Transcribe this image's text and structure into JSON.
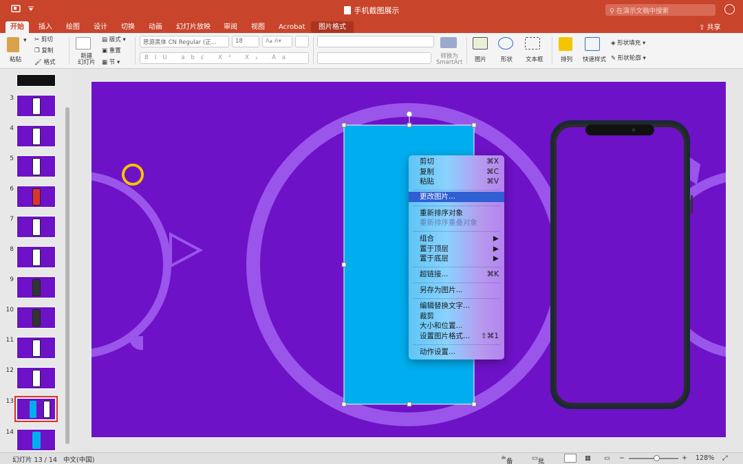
{
  "window": {
    "title": "手机截图展示",
    "search_placeholder": "在演示文稿中搜索"
  },
  "tabs": [
    {
      "label": "开始"
    },
    {
      "label": "插入"
    },
    {
      "label": "绘图"
    },
    {
      "label": "设计"
    },
    {
      "label": "切换"
    },
    {
      "label": "动画"
    },
    {
      "label": "幻灯片放映"
    },
    {
      "label": "审阅"
    },
    {
      "label": "视图"
    },
    {
      "label": "Acrobat"
    },
    {
      "label": "图片格式"
    }
  ],
  "share_label": "共享",
  "ribbon": {
    "paste": "粘贴",
    "cut": "剪切",
    "copy": "复制",
    "format": "格式",
    "new_slide_1": "新建",
    "new_slide_2": "幻灯片",
    "layout": "版式",
    "reset": "重置",
    "section": "节",
    "font_name": "思源黑体 CN Regular (正...",
    "font_size": "18",
    "convert_1": "转换为",
    "convert_2": "SmartArt",
    "picture": "图片",
    "shape": "形状",
    "textbox": "文本框",
    "arrange": "排列",
    "quick_style": "快速样式",
    "shape_fill": "形状填充",
    "shape_outline": "形状轮廓"
  },
  "slides": [
    {
      "num": ""
    },
    {
      "num": "3"
    },
    {
      "num": "4"
    },
    {
      "num": "5"
    },
    {
      "num": "6"
    },
    {
      "num": "7"
    },
    {
      "num": "8"
    },
    {
      "num": "9"
    },
    {
      "num": "10"
    },
    {
      "num": "11"
    },
    {
      "num": "12"
    },
    {
      "num": "13"
    },
    {
      "num": "14"
    }
  ],
  "context_menu": {
    "cut": "剪切",
    "cut_sc": "⌘X",
    "copy": "复制",
    "copy_sc": "⌘C",
    "paste": "粘贴",
    "paste_sc": "⌘V",
    "change_picture": "更改图片...",
    "reorder": "重新排序对象",
    "reorder_overlap": "重新排序重叠对象",
    "group": "组合",
    "bring_front": "置于顶层",
    "send_back": "置于底层",
    "hyperlink": "超链接...",
    "hyperlink_sc": "⌘K",
    "save_as_picture": "另存为图片...",
    "edit_alt_text": "编辑替换文字...",
    "crop": "裁剪",
    "size_position": "大小和位置...",
    "format_picture": "设置图片格式...",
    "format_picture_sc": "⇧⌘1",
    "action_settings": "动作设置..."
  },
  "status": {
    "slide_indicator": "幻灯片 13 / 14",
    "language": "中文(中国)",
    "notes": "备注",
    "comments": "批注",
    "zoom": "128%"
  },
  "colors": {
    "accent": "#c8442b",
    "slide_bg": "#6d12c7",
    "picture_fill": "#00aeef",
    "ring": "#f5c400"
  }
}
